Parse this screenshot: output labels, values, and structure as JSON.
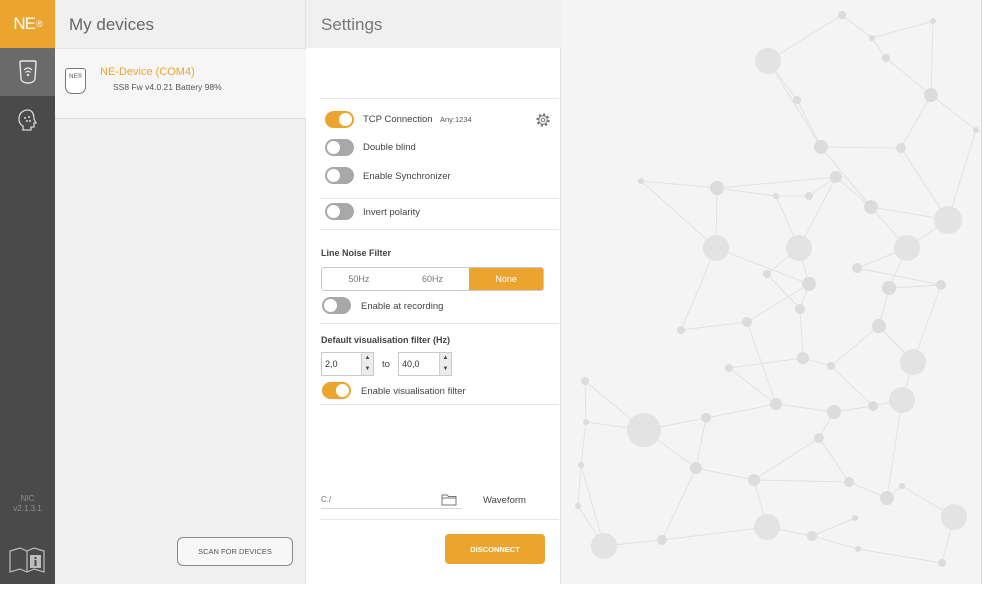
{
  "rail": {
    "logo_text": "NE",
    "logo_mark": "®",
    "version_line1": "NIC",
    "version_line2": "v2.1.3.1",
    "items": [
      {
        "icon": "wifi-device-icon"
      },
      {
        "icon": "head-icon"
      }
    ],
    "help_icon": "manual-info-icon"
  },
  "devices": {
    "title": "My devices",
    "list": [
      {
        "name": "NE-Device (COM4)",
        "info": "SS8 Fw v4.0.21 Battery 98%",
        "icon_text": "NE®"
      }
    ],
    "scan_label": "SCAN FOR DEVICES"
  },
  "settings": {
    "title": "Settings",
    "tcp": {
      "label": "TCP Connection",
      "value": "Any:1234",
      "on": true
    },
    "double_blind": {
      "label": "Double blind",
      "on": false
    },
    "synchronizer": {
      "label": "Enable Synchronizer",
      "on": false
    },
    "invert": {
      "label": "Invert polarity",
      "on": false
    },
    "line_noise": {
      "heading": "Line Noise Filter",
      "options": [
        "50Hz",
        "60Hz",
        "None"
      ],
      "selected": "None",
      "recording": {
        "label": "Enable at recording",
        "on": false
      }
    },
    "vis_filter": {
      "heading": "Default visualisation filter (Hz)",
      "from": "2,0",
      "to_label": "to",
      "to": "40,0",
      "enable": {
        "label": "Enable visualisation filter",
        "on": true
      }
    },
    "path_placeholder": "C:/",
    "waveform_label": "Waveform",
    "disconnect_label": "DISCONNECT"
  },
  "colors": {
    "accent": "#eba52e",
    "rail": "#4a4a4a",
    "panel": "#f0f0f0"
  }
}
